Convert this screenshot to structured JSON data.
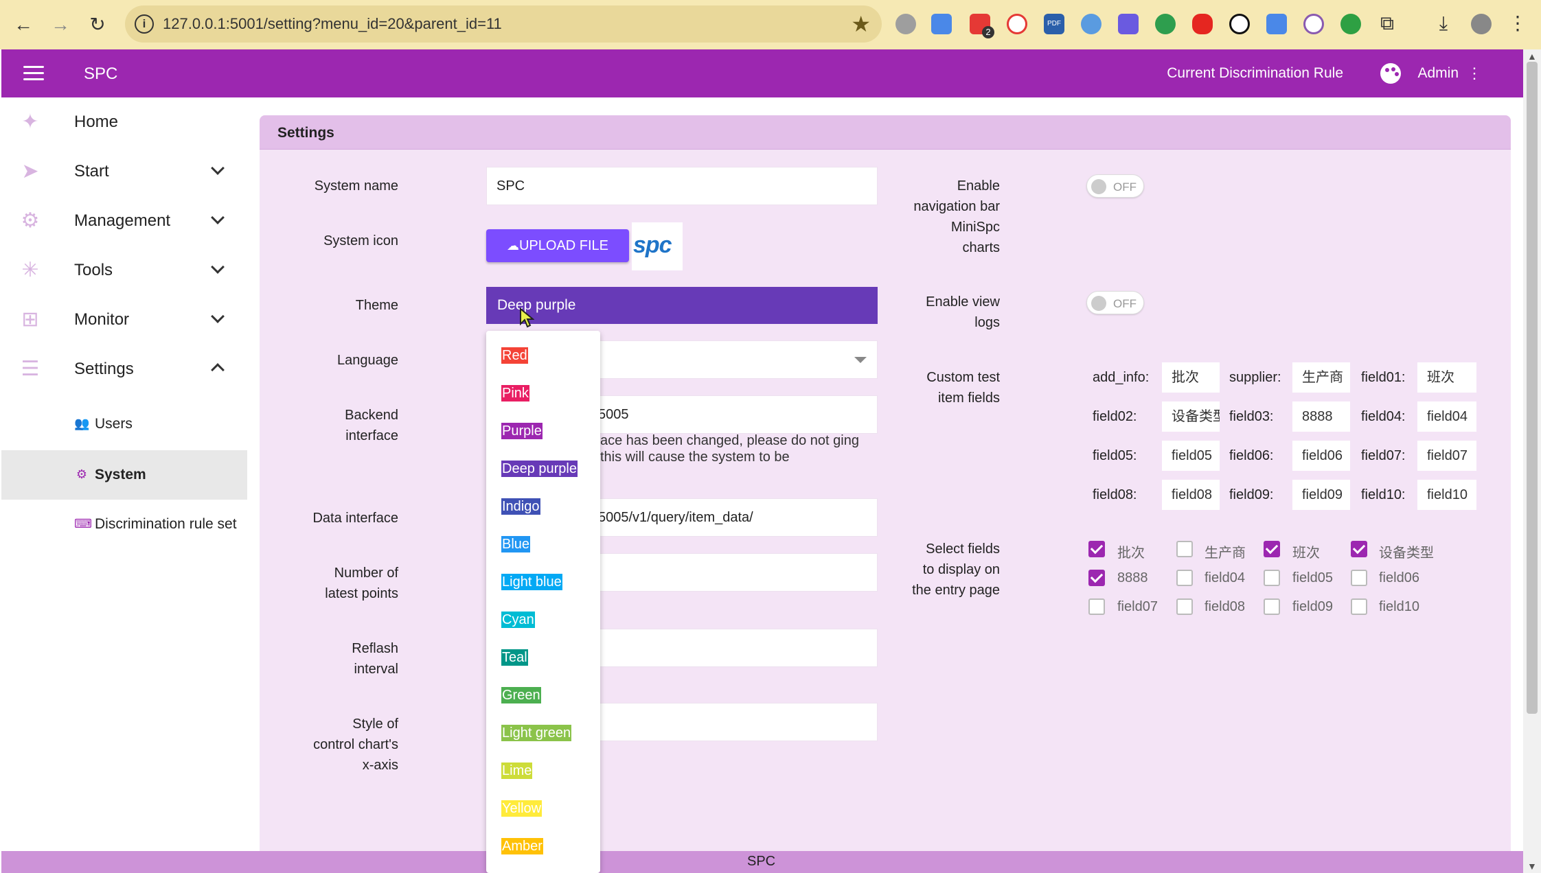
{
  "browser": {
    "url": "127.0.0.1:5001/setting?menu_id=20&parent_id=11",
    "info_glyph": "i",
    "badge_count": "2",
    "pdf_label": "PDF"
  },
  "appbar": {
    "title": "SPC",
    "rule_link": "Current Discrimination Rule",
    "user": "Admin"
  },
  "sidebar": {
    "items": [
      {
        "label": "Home",
        "icon": "home-icon"
      },
      {
        "label": "Start",
        "icon": "send-icon"
      },
      {
        "label": "Management",
        "icon": "gear-icon"
      },
      {
        "label": "Tools",
        "icon": "tools-icon"
      },
      {
        "label": "Monitor",
        "icon": "monitor-icon"
      },
      {
        "label": "Settings",
        "icon": "settings-list-icon"
      }
    ],
    "sub_items": [
      {
        "label": "Users",
        "icon": "users-icon"
      },
      {
        "label": "System",
        "icon": "gear-icon"
      },
      {
        "label": "Discrimination rule set",
        "icon": "keyboard-icon"
      }
    ]
  },
  "panel": {
    "title": "Settings",
    "labels": {
      "system_name": "System name",
      "system_icon": "System icon",
      "theme": "Theme",
      "language": "Language",
      "backend_1": "Backend",
      "backend_2": "interface",
      "data_interface": "Data interface",
      "latest_1": "Number of",
      "latest_2": "latest points",
      "reflash_1": "Reflash",
      "reflash_2": "interval",
      "style_1": "Style of",
      "style_2": "control chart's",
      "style_3": "x-axis"
    },
    "values": {
      "system_name": "SPC",
      "upload_button": "UPLOAD FILE",
      "logo_text": "spc",
      "theme": "Deep purple",
      "backend_visible": "5005",
      "backend_warning": "ace has been changed, please do not ging this will cause the system to be",
      "data_interface_visible": "5005/v1/query/item_data/"
    },
    "right": {
      "nav_1": "Enable",
      "nav_2": "navigation bar",
      "nav_3": "MiniSpc",
      "nav_4": "charts",
      "nav_toggle": "OFF",
      "logs_1": "Enable view",
      "logs_2": "logs",
      "logs_toggle": "OFF",
      "custom_1": "Custom test",
      "custom_2": "item fields",
      "select_1": "Select fields",
      "select_2": "to display on",
      "select_3": "the entry page"
    },
    "custom_fields": [
      {
        "label": "add_info:",
        "value": "批次"
      },
      {
        "label": "supplier:",
        "value": "生产商"
      },
      {
        "label": "field01:",
        "value": "班次"
      },
      {
        "label": "field02:",
        "value": "设备类型"
      },
      {
        "label": "field03:",
        "value": "8888"
      },
      {
        "label": "field04:",
        "value": "field04"
      },
      {
        "label": "field05:",
        "value": "field05"
      },
      {
        "label": "field06:",
        "value": "field06"
      },
      {
        "label": "field07:",
        "value": "field07"
      },
      {
        "label": "field08:",
        "value": "field08"
      },
      {
        "label": "field09:",
        "value": "field09"
      },
      {
        "label": "field10:",
        "value": "field10"
      }
    ],
    "display_fields": [
      {
        "label": "批次",
        "checked": true
      },
      {
        "label": "生产商",
        "checked": false
      },
      {
        "label": "班次",
        "checked": true
      },
      {
        "label": "设备类型",
        "checked": true
      },
      {
        "label": "8888",
        "checked": true
      },
      {
        "label": "field04",
        "checked": false
      },
      {
        "label": "field05",
        "checked": false
      },
      {
        "label": "field06",
        "checked": false
      },
      {
        "label": "field07",
        "checked": false
      },
      {
        "label": "field08",
        "checked": false
      },
      {
        "label": "field09",
        "checked": false
      },
      {
        "label": "field10",
        "checked": false
      }
    ]
  },
  "theme_options": [
    {
      "label": "Red",
      "color": "#f44336"
    },
    {
      "label": "Pink",
      "color": "#e91e63"
    },
    {
      "label": "Purple",
      "color": "#9c27b0"
    },
    {
      "label": "Deep purple",
      "color": "#673ab7"
    },
    {
      "label": "Indigo",
      "color": "#3f51b5"
    },
    {
      "label": "Blue",
      "color": "#2196f3"
    },
    {
      "label": "Light blue",
      "color": "#03a9f4"
    },
    {
      "label": "Cyan",
      "color": "#00bcd4"
    },
    {
      "label": "Teal",
      "color": "#009688"
    },
    {
      "label": "Green",
      "color": "#4caf50"
    },
    {
      "label": "Light green",
      "color": "#8bc34a"
    },
    {
      "label": "Lime",
      "color": "#cddc39"
    },
    {
      "label": "Yellow",
      "color": "#ffeb3b"
    },
    {
      "label": "Amber",
      "color": "#ffc107"
    }
  ],
  "footer": {
    "text": "SPC"
  },
  "colors": {
    "primary": "#9c27b0",
    "theme_select": "#673ab7",
    "upload": "#7c4dff"
  }
}
